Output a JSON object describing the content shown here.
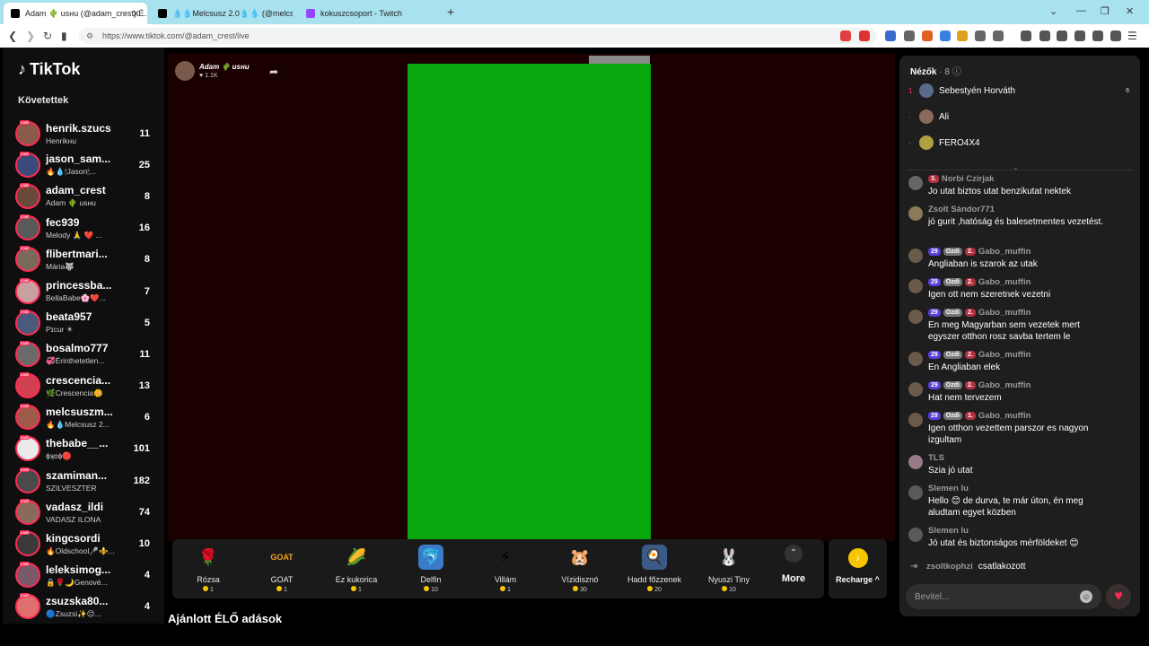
{
  "browser": {
    "tabs": [
      {
        "title": "Adam 🌵 usнu (@adam_crest) É...",
        "active": true
      },
      {
        "title": "💧💧Melcsusz 2.0💧💧 (@melcsu",
        "active": false
      },
      {
        "title": "kokuszcsoport - Twitch",
        "active": false
      }
    ],
    "url": "https://www.tiktok.com/@adam_crest/live"
  },
  "sidebar": {
    "logo": "TikTok",
    "following_title": "Követettek",
    "live_tag": "LIVE",
    "items": [
      {
        "name": "henrik.szucs",
        "sub": "Henrikнu",
        "count": "11",
        "color": "#8a5a4a"
      },
      {
        "name": "jason_sam...",
        "sub": "🔥💧🕯Jason🕯...",
        "count": "25",
        "color": "#3a4a7a"
      },
      {
        "name": "adam_crest",
        "sub": "Adam 🌵 usнu",
        "count": "8",
        "color": "#6a4a3a"
      },
      {
        "name": "fec939",
        "sub": "Melody 🙏 ❤️ ...",
        "count": "16",
        "color": "#5a5a5a"
      },
      {
        "name": "flibertmari...",
        "sub": "Mária🐺",
        "count": "8",
        "color": "#7a6a5a"
      },
      {
        "name": "princessba...",
        "sub": "BellaBabe🌸❤️...",
        "count": "7",
        "color": "#c9a0a0"
      },
      {
        "name": "beata957",
        "sub": "Pɪcur ☀",
        "count": "5",
        "color": "#4a5a7a"
      },
      {
        "name": "bosalmo777",
        "sub": "💞Érinthetetlen...",
        "count": "11",
        "color": "#6a6a6a"
      },
      {
        "name": "crescencia...",
        "sub": "🌿Crescencia🌼",
        "count": "13",
        "color": "#d04050"
      },
      {
        "name": "melcsuszm...",
        "sub": "🔥💧Melcsusz 2...",
        "count": "6",
        "color": "#a05a4a"
      },
      {
        "name": "thebabe__...",
        "sub": "ɸʞɒɸ🔴",
        "count": "101",
        "color": "#eaeaea"
      },
      {
        "name": "szamiman...",
        "sub": "SZILVESZTER",
        "count": "182",
        "color": "#4a4a4a"
      },
      {
        "name": "vadasz_ildi",
        "sub": "VADASZ ILONA",
        "count": "74",
        "color": "#8a6a5a"
      },
      {
        "name": "kingcsordi",
        "sub": "🔥Oldschool🎤⚜️...",
        "count": "10",
        "color": "#3a3a3a"
      },
      {
        "name": "leleksimog...",
        "sub": "🔒🌹🌙Genové...",
        "count": "4",
        "color": "#7a5a6a"
      },
      {
        "name": "zsuzska80...",
        "sub": "🔵Zsuzsi✨😊...",
        "count": "4",
        "color": "#e07070"
      }
    ]
  },
  "stage": {
    "host_name": "Adam 🌵 usнu",
    "host_likes": "♥ 1.1K",
    "video_color": "#06a80d"
  },
  "gifts": [
    {
      "name": "Rózsa",
      "price": "1",
      "icon": "🌹",
      "bg": "transparent"
    },
    {
      "name": "GOAT",
      "price": "1",
      "icon": "GOAT",
      "bg": "transparent"
    },
    {
      "name": "Ez kukorica",
      "price": "1",
      "icon": "🌽",
      "bg": "transparent"
    },
    {
      "name": "Delfin",
      "price": "10",
      "icon": "🐬",
      "bg": "#3b7cc9"
    },
    {
      "name": "Villám",
      "price": "1",
      "icon": "⚡",
      "bg": "transparent"
    },
    {
      "name": "Vízidisznó",
      "price": "30",
      "icon": "🐹",
      "bg": "transparent"
    },
    {
      "name": "Hadd főzzenek",
      "price": "20",
      "icon": "🍳",
      "bg": "#3a5a8a"
    },
    {
      "name": "Nyuszi Tiny",
      "price": "10",
      "icon": "🐰",
      "bg": "transparent"
    }
  ],
  "more_label": "More",
  "recharge_label": "Recharge ^",
  "recommended_title": "Ajánlott ÉLŐ adások",
  "viewers": {
    "title": "Nézők",
    "count": "· 8",
    "list": [
      {
        "rank": "1",
        "name": "Sebestyén Horváth",
        "score": "6",
        "color": "#5a6a8a"
      },
      {
        "rank": "-",
        "name": "Ali",
        "score": "",
        "color": "#8a6a5a"
      },
      {
        "rank": "-",
        "name": "FERO4X4",
        "score": "",
        "color": "#b0a040"
      }
    ]
  },
  "chat": [
    {
      "name": "Norbi Czirjak",
      "badges": [
        {
          "t": "3.",
          "k": "sub"
        }
      ],
      "text": "Jo utat biztos utat benzikutat nektek",
      "color": "#666"
    },
    {
      "name": "Zsolt Sándor771",
      "badges": [],
      "text": "jó gurit ,hatóság és balesetmentes vezetést.",
      "color": "#8a7a5a"
    },
    {
      "name": "Gabo_muffin",
      "badges": [
        {
          "t": "29",
          "k": "level"
        },
        {
          "t": "Ozdi",
          "k": "fan"
        },
        {
          "t": "2.",
          "k": "sub"
        }
      ],
      "text": "Angliaban is szarok az utak",
      "color": "#6a5a4a"
    },
    {
      "name": "Gabo_muffin",
      "badges": [
        {
          "t": "29",
          "k": "level"
        },
        {
          "t": "Ozdi",
          "k": "fan"
        },
        {
          "t": "2.",
          "k": "sub"
        }
      ],
      "text": "Igen ott nem szeretnek vezetni",
      "color": "#6a5a4a"
    },
    {
      "name": "Gabo_muffin",
      "badges": [
        {
          "t": "29",
          "k": "level"
        },
        {
          "t": "Ozdi",
          "k": "fan"
        },
        {
          "t": "2.",
          "k": "sub"
        }
      ],
      "text": "En meg Magyarban sem vezetek mert egyszer otthon rosz savba tertem le",
      "color": "#6a5a4a"
    },
    {
      "name": "Gabo_muffin",
      "badges": [
        {
          "t": "29",
          "k": "level"
        },
        {
          "t": "Ozdi",
          "k": "fan"
        },
        {
          "t": "2.",
          "k": "sub"
        }
      ],
      "text": "En Angliaban elek",
      "color": "#6a5a4a"
    },
    {
      "name": "Gabo_muffin",
      "badges": [
        {
          "t": "29",
          "k": "level"
        },
        {
          "t": "Ozdi",
          "k": "fan"
        },
        {
          "t": "2.",
          "k": "sub"
        }
      ],
      "text": "Hat nem tervezem",
      "color": "#6a5a4a"
    },
    {
      "name": "Gabo_muffin",
      "badges": [
        {
          "t": "29",
          "k": "level"
        },
        {
          "t": "Ozdi",
          "k": "fan"
        },
        {
          "t": "1.",
          "k": "sub"
        }
      ],
      "text": "Igen otthon vezettem parszor es nagyon izgultam",
      "color": "#6a5a4a"
    },
    {
      "name": "TLS",
      "badges": [],
      "text": "Szia jó utat",
      "color": "#9a7a8a"
    },
    {
      "name": "Slemen lu",
      "badges": [],
      "text": "Hello 😊 de durva, te már úton, én meg aludtam egyet közben",
      "color": "#5a5a5a"
    },
    {
      "name": "Slemen lu",
      "badges": [],
      "text": "Jó utat és biztonságos mérföldeket 😊",
      "color": "#5a5a5a"
    }
  ],
  "joined": {
    "name": "zsoltkophzi",
    "text": "csatlakozott"
  },
  "chat_input": {
    "placeholder": "Bevitel..."
  }
}
